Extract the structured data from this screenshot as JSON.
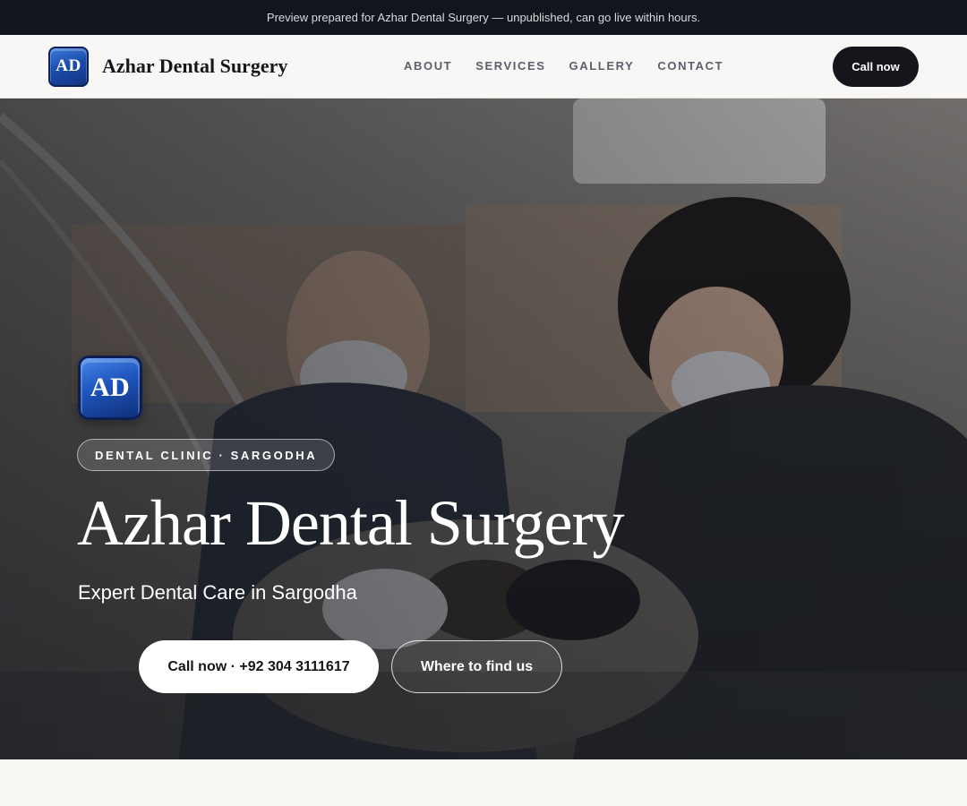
{
  "preview_bar": {
    "text": "Preview prepared for Azhar Dental Surgery — unpublished, can go live within hours."
  },
  "header": {
    "logo_initials": "AD",
    "brand_name": "Azhar Dental Surgery",
    "nav": [
      {
        "label": "ABOUT"
      },
      {
        "label": "SERVICES"
      },
      {
        "label": "GALLERY"
      },
      {
        "label": "CONTACT"
      }
    ],
    "cta_label": "Call now"
  },
  "hero": {
    "logo_initials": "AD",
    "tag": "DENTAL CLINIC · SARGODHA",
    "title": "Azhar Dental Surgery",
    "subtitle": "Expert Dental Care in Sargodha",
    "primary_button": "Call now · +92 304 3111617",
    "secondary_button": "Where to find us"
  },
  "colors": {
    "banner_bg": "#12151b",
    "header_bg": "#f8f7f5",
    "accent_dark": "#14161b",
    "logo_blue": "#1d4fb0"
  }
}
